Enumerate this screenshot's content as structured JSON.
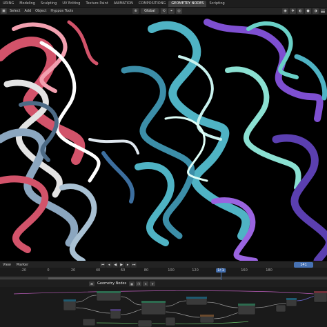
{
  "workspaces": [
    "URING",
    "Modeling",
    "Sculpting",
    "UV Editing",
    "Texture Paint",
    "ANIMATION",
    "COMPOSITIONG",
    "GEOMETRY NODES",
    "Scripting"
  ],
  "active_workspace": "GEOMETRY NODES",
  "header": {
    "menu_items": [
      "Select",
      "Add",
      "Object",
      "Hyppos Tools"
    ],
    "orientation": "Global"
  },
  "timeline": {
    "menu_items": [
      "View",
      "Marker"
    ],
    "ticks": [
      "-20",
      "0",
      "20",
      "40",
      "60",
      "80",
      "100",
      "120",
      "141",
      "160",
      "180"
    ],
    "current_frame": "141",
    "frame_field": "141"
  },
  "node_editor": {
    "title": "Geometry Nodes"
  },
  "colors": {
    "accent": "#4772b3",
    "left_swirl": "#d2536a",
    "right_swirl": "#4fb3c4"
  }
}
